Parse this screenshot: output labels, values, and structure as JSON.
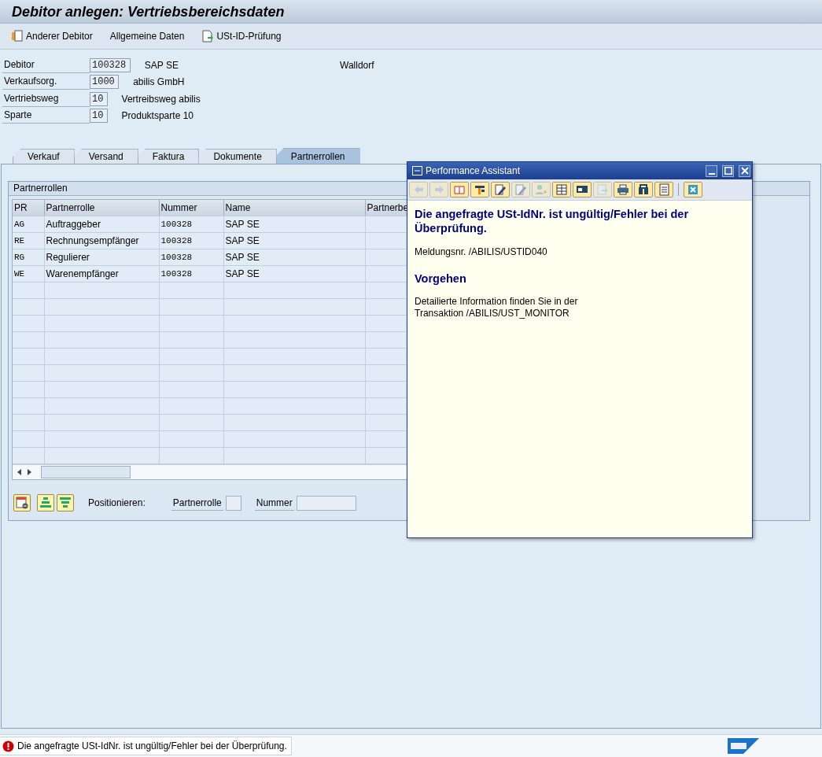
{
  "window": {
    "title": "Debitor anlegen: Vertriebsbereichsdaten"
  },
  "toolbar": [
    {
      "label": "Anderer Debitor",
      "kind": "copy"
    },
    {
      "label": "Allgemeine Daten",
      "kind": "text"
    },
    {
      "label": "USt-ID-Prüfung",
      "kind": "document"
    }
  ],
  "header_fields": [
    {
      "label": "Debitor",
      "value": "100328",
      "description": "SAP SE",
      "extra": "Walldorf"
    },
    {
      "label": "Verkaufsorg.",
      "value": "1000",
      "description": "abilis GmbH"
    },
    {
      "label": "Vertriebsweg",
      "value": "10",
      "description": "Vertreibsweg abilis"
    },
    {
      "label": "Sparte",
      "value": "10",
      "description": "Produktsparte 10"
    }
  ],
  "tabs": [
    {
      "label": "Verkauf",
      "selected": false
    },
    {
      "label": "Versand",
      "selected": false
    },
    {
      "label": "Faktura",
      "selected": false
    },
    {
      "label": "Dokumente",
      "selected": false
    },
    {
      "label": "Partnerrollen",
      "selected": true
    }
  ],
  "group": {
    "title": "Partnerrollen",
    "table": {
      "columns": [
        "PR",
        "Partnerrolle",
        "Nummer",
        "Name",
        "Partnerbe"
      ],
      "rows": [
        [
          "AG",
          "Auftraggeber",
          "100328",
          "SAP SE",
          ""
        ],
        [
          "RE",
          "Rechnungsempfänger",
          "100328",
          "SAP SE",
          ""
        ],
        [
          "RG",
          "Regulierer",
          "100328",
          "SAP SE",
          ""
        ],
        [
          "WE",
          "Warenempfänger",
          "100328",
          "SAP SE",
          ""
        ]
      ]
    },
    "position": {
      "label": "Positionieren:",
      "fields": [
        {
          "label": "Partnerrolle"
        },
        {
          "label": "Nummer"
        }
      ]
    }
  },
  "popup": {
    "title": "Performance Assistant",
    "toolbar": [
      {
        "kind": "back",
        "disabled": true
      },
      {
        "kind": "forward",
        "disabled": true
      },
      {
        "kind": "book",
        "disabled": false
      },
      {
        "kind": "tools",
        "disabled": false
      },
      {
        "kind": "pencil",
        "disabled": false
      },
      {
        "kind": "pencil",
        "disabled": true
      },
      {
        "kind": "person",
        "disabled": true
      },
      {
        "kind": "table",
        "disabled": false
      },
      {
        "kind": "card",
        "disabled": false
      },
      {
        "kind": "export",
        "disabled": true
      },
      {
        "kind": "printer",
        "disabled": false
      },
      {
        "kind": "binoculars",
        "disabled": false
      },
      {
        "kind": "list",
        "disabled": false
      },
      {
        "kind": "close",
        "disabled": false
      }
    ],
    "heading": "Die angefragte USt-IdNr. ist ungültig/Fehler bei der Überprüfung.",
    "message_no": "Meldungsnr. /ABILIS/USTID040",
    "section": "Vorgehen",
    "text_lines": [
      "Detailierte Information finden Sie in der",
      "Transaktion /ABILIS/UST_MONITOR"
    ]
  },
  "status_bar": {
    "kind": "error",
    "message": "Die angefragte USt-IdNr. ist ungültig/Fehler bei der Überprüfung."
  }
}
